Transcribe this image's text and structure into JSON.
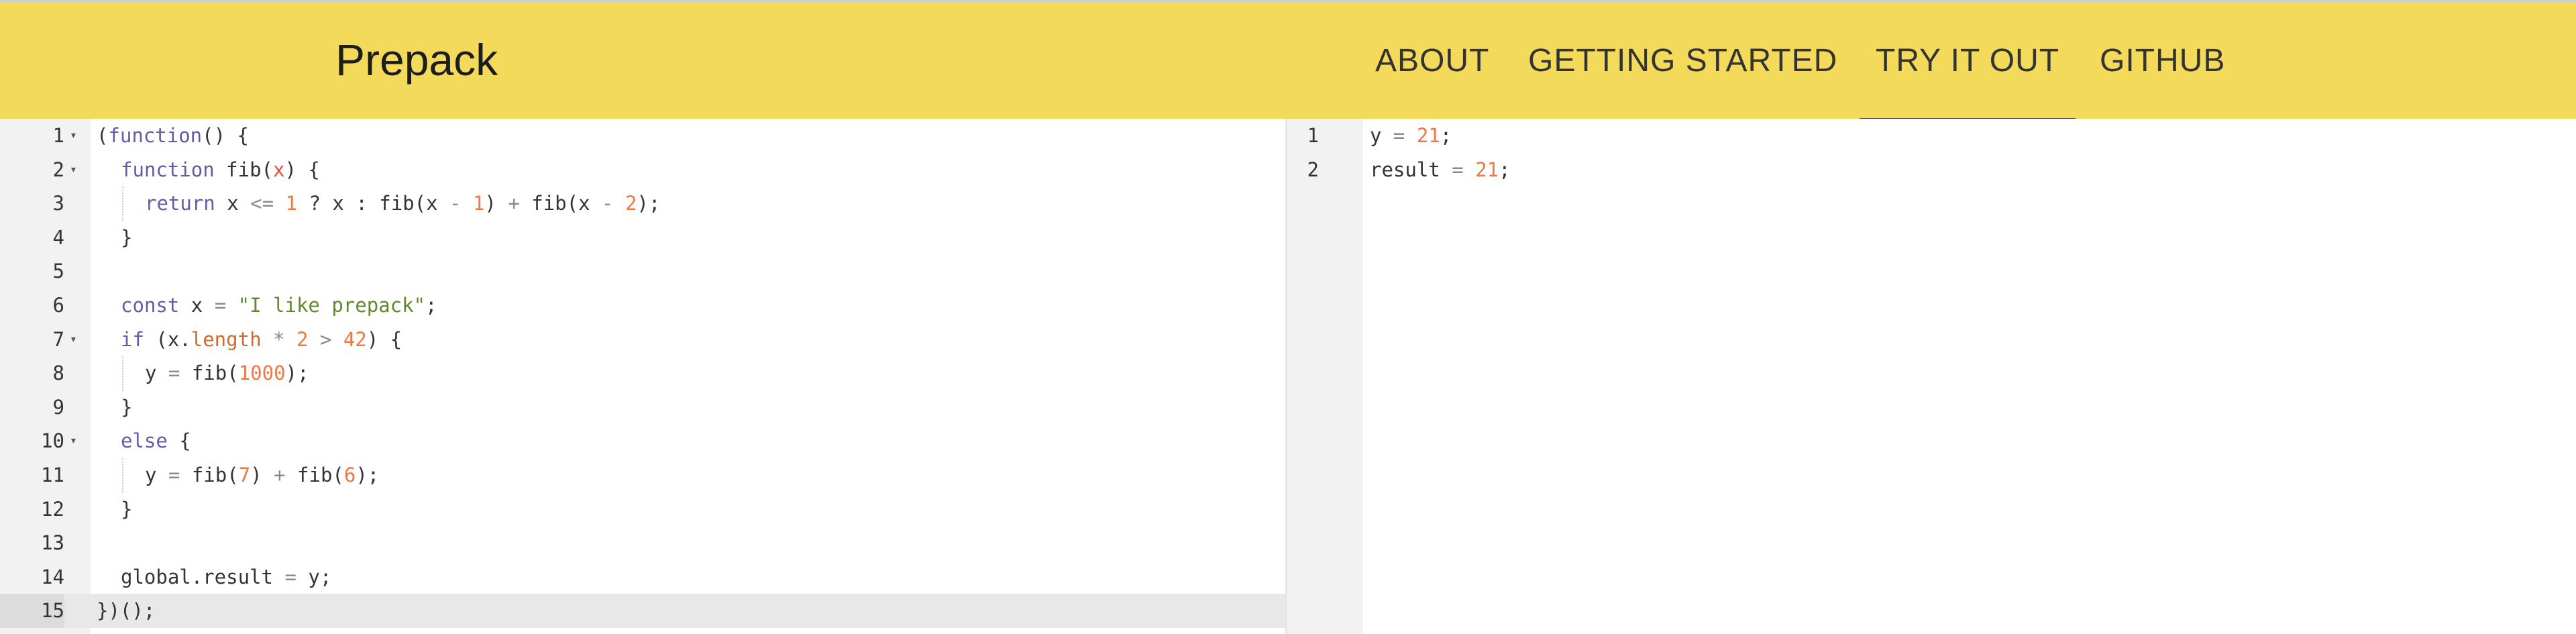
{
  "header": {
    "brand": "Prepack",
    "nav": {
      "about": "ABOUT",
      "getting_started": "GETTING STARTED",
      "try_it_out": "TRY IT OUT",
      "github": "GITHUB"
    },
    "active_nav": "TRY IT OUT"
  },
  "input_editor": {
    "line_numbers": [
      "1",
      "2",
      "3",
      "4",
      "5",
      "6",
      "7",
      "8",
      "9",
      "10",
      "11",
      "12",
      "13",
      "14",
      "15"
    ],
    "active_line": "15",
    "lines": {
      "l1": {
        "open": "(",
        "kw": "function",
        "rest": "() {"
      },
      "l2": {
        "kw": "function",
        "name": " fib(",
        "param": "x",
        "rest": ") {"
      },
      "l3": {
        "kw": "return",
        "a": " x ",
        "op1": "<=",
        "sp1": " ",
        "n1": "1",
        "b": " ? x : fib(x ",
        "op2": "-",
        "sp2": " ",
        "n2": "1",
        "c": ") ",
        "op3": "+",
        "d": " fib(x ",
        "op4": "-",
        "sp3": " ",
        "n3": "2",
        "e": ");"
      },
      "l4": {
        "text": "}"
      },
      "l6": {
        "kw": "const",
        "a": " x ",
        "op": "=",
        "sp": " ",
        "str": "\"I like prepack\"",
        "e": ";"
      },
      "l7": {
        "kw": "if",
        "a": " (x.",
        "prop": "length",
        "sp": " ",
        "op1": "*",
        "sp2": " ",
        "n1": "2",
        "sp3": " ",
        "op2": ">",
        "sp4": " ",
        "n2": "42",
        "e": ") {"
      },
      "l8": {
        "a": "y ",
        "op": "=",
        "b": " fib(",
        "n": "1000",
        "e": ");"
      },
      "l9": {
        "text": "}"
      },
      "l10": {
        "kw": "else",
        "e": " {"
      },
      "l11": {
        "a": "y ",
        "op1": "=",
        "b": " fib(",
        "n1": "7",
        "c": ") ",
        "op2": "+",
        "d": " fib(",
        "n2": "6",
        "e": ");"
      },
      "l12": {
        "text": "}"
      },
      "l14": {
        "a": "global.result ",
        "op": "=",
        "e": " y;"
      },
      "l15": {
        "text": "})();"
      }
    }
  },
  "output_editor": {
    "line_numbers": [
      "1",
      "2"
    ],
    "lines": {
      "l1": {
        "a": "y ",
        "op": "=",
        "sp": " ",
        "n": "21",
        "e": ";"
      },
      "l2": {
        "a": "result ",
        "op": "=",
        "sp": " ",
        "n": "21",
        "e": ";"
      }
    }
  },
  "colors": {
    "header_bg": "#f4da5a",
    "keyword": "#6a5aa6",
    "number": "#f07844",
    "string": "#5f8a2c",
    "operator": "#8a8a8a"
  }
}
